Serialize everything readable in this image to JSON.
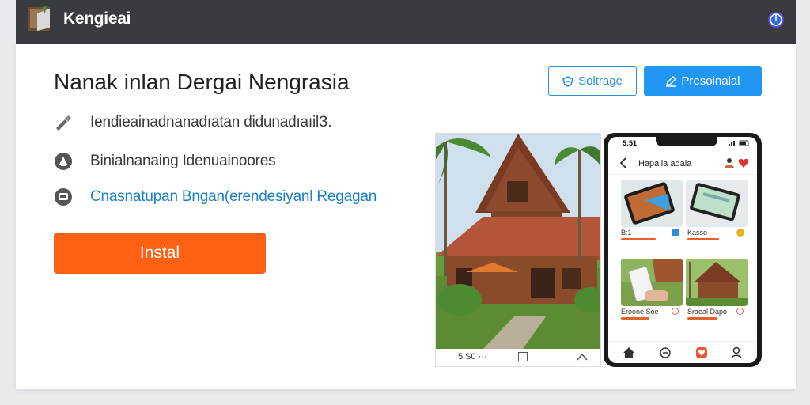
{
  "topbar": {
    "app_title": "Kengieai",
    "logo_icon": "book-icon",
    "right_icon": "globe-icon"
  },
  "main": {
    "headline": "Nanak inlan Dergai Nengrasia",
    "features": [
      {
        "icon": "wrench-icon",
        "text": "Iendieainadnanadıatan didunadıaıilЗ."
      },
      {
        "icon": "bell-icon",
        "text": "Binialnanaing Idenuainoores"
      },
      {
        "icon": "message-icon",
        "text": "Cnasnatupan Bngan(erendesiyanl Regagan"
      }
    ],
    "install_label": "Instal"
  },
  "actions": {
    "outline_label": "Soltrage",
    "outline_icon": "shield-icon",
    "solid_label": "Presoinalal",
    "solid_icon": "edit-icon"
  },
  "photo": {
    "caption": "5.S0 ···"
  },
  "phone": {
    "time": "5:51",
    "header_title": "Hapalia adala",
    "tiles": [
      {
        "title": "B:1",
        "price_color": "#e8632b"
      },
      {
        "title": "Kasso",
        "price_color": "#e8632b"
      },
      {
        "title": "Eroone Soe",
        "price_color": "#e8632b"
      },
      {
        "title": "Sraeal Dapo",
        "price_color": "#e8632b"
      }
    ]
  },
  "colors": {
    "accent_orange": "#ff6114",
    "accent_blue": "#2196f3",
    "link_blue": "#1a7fc8"
  }
}
